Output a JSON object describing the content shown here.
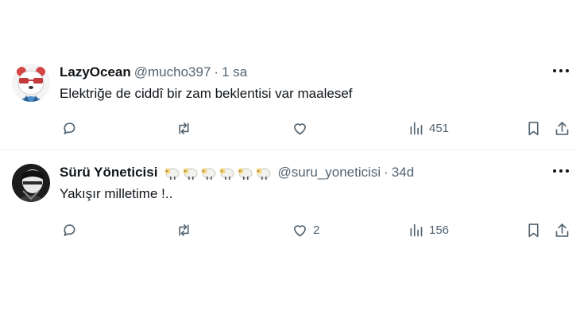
{
  "tweets": [
    {
      "name": "LazyOcean",
      "handle": "@mucho397",
      "separator": "·",
      "time": "1 sa",
      "text": "Elektriğe de ciddî bir zam beklentisi var maalesef",
      "likes": "",
      "views": "451",
      "avatar_icon": "panda-with-sunglasses-avatar"
    },
    {
      "name": "Sürü Yöneticisi",
      "name_emojis": [
        "sheep",
        "sheep",
        "sheep",
        "sheep",
        "sheep",
        "sheep"
      ],
      "handle": "@suru_yoneticisi",
      "separator": "·",
      "time": "34d",
      "text": "Yakışır milletime !..",
      "likes": "2",
      "views": "156",
      "avatar_icon": "masked-person-avatar"
    }
  ],
  "colors": {
    "muted": "#536471",
    "text": "#0f1419",
    "divider": "#eff3f4"
  }
}
